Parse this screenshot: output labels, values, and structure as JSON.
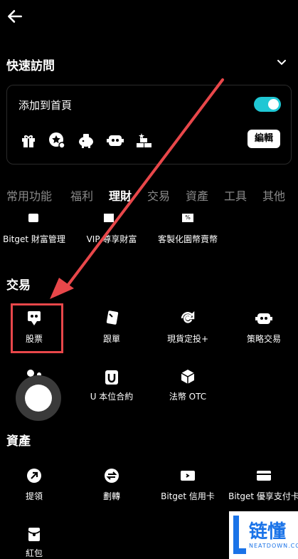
{
  "header": {
    "back_icon": "arrow-left-icon"
  },
  "quick_access": {
    "title": "快速訪問",
    "add_to_home_label": "添加到首頁",
    "toggle_on": true,
    "edit_label": "編輯",
    "shortcut_icons": [
      "gift-icon",
      "star-badge-icon",
      "piggy-bank-icon",
      "robot-icon",
      "gold-bars-icon"
    ]
  },
  "tabs": [
    {
      "label": "常用功能",
      "active": false
    },
    {
      "label": "福利",
      "active": false
    },
    {
      "label": "理財",
      "active": true
    },
    {
      "label": "交易",
      "active": false
    },
    {
      "label": "資產",
      "active": false
    },
    {
      "label": "工具",
      "active": false
    },
    {
      "label": "其他",
      "active": false
    }
  ],
  "wealth_items": [
    {
      "label": "Bitget 財富管理"
    },
    {
      "label": "VIP 尊享財富"
    },
    {
      "label": "客製化園幣賣幣"
    }
  ],
  "trading": {
    "title": "交易",
    "items": [
      {
        "label": "股票",
        "icon": "stock-icon"
      },
      {
        "label": "跟單",
        "icon": "copy-trade-icon"
      },
      {
        "label": "現貨定投+",
        "icon": "recurring-buy-icon"
      },
      {
        "label": "策略交易",
        "icon": "strategy-bot-icon"
      },
      {
        "label": "U 本位合約",
        "icon": "usdt-futures-icon"
      },
      {
        "label": "法幣 OTC",
        "icon": "otc-box-icon"
      }
    ]
  },
  "assets": {
    "title": "資產",
    "items": [
      {
        "label": "提領",
        "icon": "withdraw-icon"
      },
      {
        "label": "劃轉",
        "icon": "transfer-icon"
      },
      {
        "label": "Bitget 信用卡",
        "icon": "credit-card-icon"
      },
      {
        "label": "Bitget 優享支付卡",
        "icon": "pay-card-icon"
      },
      {
        "label": "紅包",
        "icon": "red-packet-icon"
      }
    ]
  },
  "watermark": {
    "text": "链懂",
    "sub": "NEATDOWN.COM"
  },
  "colors": {
    "accent": "#1fc7d4",
    "highlight": "#e8474a",
    "background": "#000000"
  }
}
